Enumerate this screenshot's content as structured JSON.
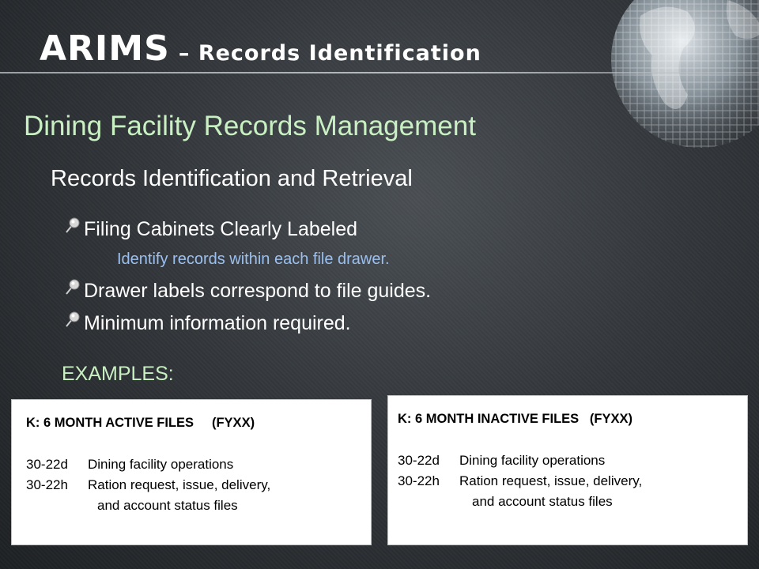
{
  "header": {
    "title": "ARIMS",
    "title_suffix": "– Records Identification"
  },
  "subtitle": "Dining Facility Records Management",
  "section_heading": "Records Identification and Retrieval",
  "bullets": [
    "Filing Cabinets Clearly Labeled",
    "Drawer labels correspond to file guides.",
    "Minimum information required."
  ],
  "sub_note": "Identify records within each file drawer.",
  "examples_label": "EXAMPLES:",
  "examples": [
    {
      "title": "K: 6 MONTH ACTIVE FILES     (FYXX)",
      "rows": [
        {
          "code": "30-22d",
          "desc": "Dining facility operations"
        },
        {
          "code": "30-22h",
          "desc": "Ration request, issue, delivery,"
        }
      ],
      "continuation": "and account status files"
    },
    {
      "title": "K: 6 MONTH INACTIVE FILES   (FYXX)",
      "rows": [
        {
          "code": "30-22d",
          "desc": "Dining facility operations"
        },
        {
          "code": "30-22h",
          "desc": "Ration request, issue, delivery,"
        }
      ],
      "continuation": "and account status files"
    }
  ],
  "colors": {
    "background": "#33373b",
    "title": "#ffffff",
    "subtitle": "#c9f0c2",
    "note": "#9bc0ef",
    "box": "#ffffff"
  },
  "icons": {
    "bullet": "pin-bullet-icon",
    "decoration": "wireframe-globe-icon"
  }
}
